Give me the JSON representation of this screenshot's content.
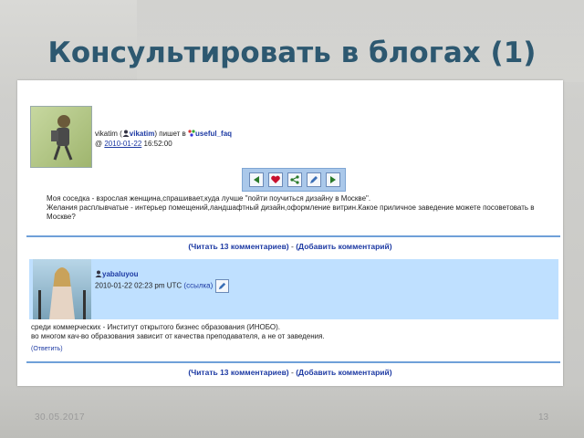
{
  "slide": {
    "title": "Консультировать в блогах (1)",
    "footer_date": "30.05.2017",
    "page_number": "13"
  },
  "post1": {
    "author": "vikatim",
    "open_paren": "(",
    "user_link": "vikatim",
    "writes_in": ") пишет в",
    "community": "useful_faq",
    "at": "@",
    "date": "2010-01-22",
    "time": "16:52:00",
    "toolbar_icons": [
      "prev-arrow-icon",
      "heart-icon",
      "share-icon",
      "edit-icon",
      "next-arrow-icon"
    ],
    "body_line1": "Моя соседка - взрослая женщина,спрашивает,куда лучше \"пойти поучиться дизайну в Москве\".",
    "body_line2": "Желания расплывчатые - интерьер помещений,ландшафтный дизайн,оформление витрин.Какое приличное заведение можете посоветовать в",
    "body_line3": "Москве?"
  },
  "comments_bar": {
    "read": "(Читать 13 комментариев)",
    "sep": " - ",
    "add": "(Добавить комментарий)"
  },
  "post2": {
    "user": "yabaluyou",
    "datetime": "2010-01-22 02:23 pm UTC",
    "link": "(ссылка)",
    "body_line1": "среди коммерческих - Институт открытого бизнес образования (ИНОБО).",
    "body_line2": "во многом кач-во образования зависит от качества преподавателя, а не от заведения.",
    "reply": "(Ответить)"
  },
  "colors": {
    "title": "#2d5870",
    "link": "#1d3aa3",
    "toolbar_bg": "#aac8ea",
    "comment_bg": "#bfe0ff"
  }
}
